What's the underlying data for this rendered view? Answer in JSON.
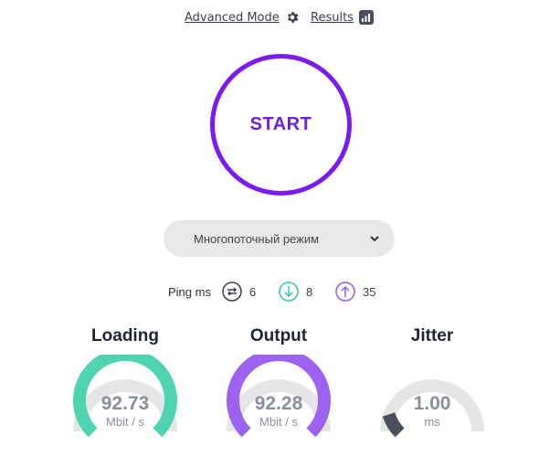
{
  "header": {
    "advanced_mode_label": "Advanced Mode",
    "results_label": "Results"
  },
  "start_button": {
    "label": "START"
  },
  "mode_select": {
    "value": "Многопоточный режим"
  },
  "ping": {
    "label": "Ping ms",
    "items": [
      {
        "name": "ping",
        "value": "6",
        "color": "#3b3f4a"
      },
      {
        "name": "download",
        "value": "8",
        "color": "#37c7a6"
      },
      {
        "name": "upload",
        "value": "35",
        "color": "#8f5cf0"
      }
    ]
  },
  "gauges": [
    {
      "title": "Loading",
      "value": "92.73",
      "unit": "Mbit / s",
      "color": "#4fd3b0",
      "fraction": 1.0
    },
    {
      "title": "Output",
      "value": "92.28",
      "unit": "Mbit / s",
      "color": "#9b63ef",
      "fraction": 1.0
    },
    {
      "title": "Jitter",
      "value": "1.00",
      "unit": "ms",
      "color": "#4a4f5a",
      "fraction": 0.1
    }
  ],
  "colors": {
    "accent": "#7b1bf0",
    "gauge_track": "#e6e6e8"
  }
}
